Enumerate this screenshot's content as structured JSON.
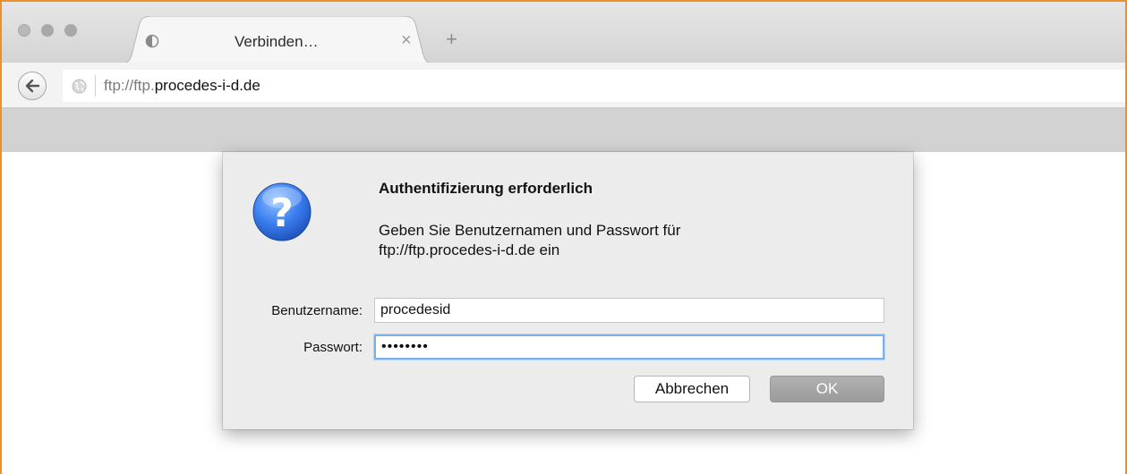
{
  "browser": {
    "window_controls": [
      "close",
      "minimize",
      "zoom"
    ],
    "tab": {
      "title": "Verbinden…",
      "close_glyph": "×",
      "loading_icon": "loading-spinner-icon"
    },
    "new_tab_glyph": "+",
    "nav": {
      "back_icon": "back-arrow-icon",
      "site_icon": "globe-icon",
      "url_scheme": "ftp://ftp.",
      "url_host": "procedes-i-d.de"
    }
  },
  "dialog": {
    "icon": "question-mark-icon",
    "title": "Authentifizierung erforderlich",
    "message_line1": "Geben Sie Benutzernamen und Passwort für",
    "message_line2": "ftp://ftp.procedes-i-d.de ein",
    "username_label": "Benutzername:",
    "username_value": "procedesid",
    "password_label": "Passwort:",
    "password_value": "••••••••",
    "cancel_label": "Abbrechen",
    "ok_label": "OK"
  },
  "colors": {
    "frame_accent": "#e8912f",
    "focus_ring": "#7fb0ea",
    "question_icon_blue": "#2f6fe0"
  }
}
